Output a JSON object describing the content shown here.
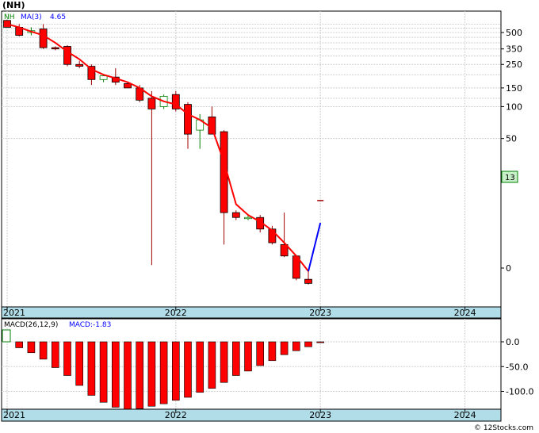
{
  "ticker": "(NH)",
  "price_legend": {
    "symbol": "NH",
    "ma_label": "MA(3)",
    "ma_value": "4.65"
  },
  "macd_legend": {
    "label": "MACD(26,12,9)",
    "value_label": "MACD:-1.83"
  },
  "last_price_badge": "13",
  "copyright": "© 12Stocks.com",
  "colors": {
    "up": "#ffffff",
    "down": "#ff0000",
    "ma_line": "#ff0000",
    "ma_last": "#0000ff",
    "legend_symbol": "#008000",
    "legend_ma": "#0000ff",
    "axis_bar": "#b0dde8",
    "badge_bg": "#c8f0c8",
    "badge_border": "#008000"
  },
  "chart_data": [
    {
      "type": "candlestick",
      "title": "(NH)",
      "scale": "log",
      "y_tick_labels": [
        "500",
        "350",
        "250",
        "150",
        "100",
        "50",
        "0"
      ],
      "y_tick_values": [
        500,
        350,
        250,
        150,
        100,
        50,
        3
      ],
      "x_tick_labels": [
        "2021",
        "2022",
        "2023",
        "2024"
      ],
      "x_tick_months": [
        0,
        14,
        26,
        38
      ],
      "grid": true,
      "ohlc": [
        {
          "m": 0,
          "o": 650,
          "h": 660,
          "l": 560,
          "c": 560
        },
        {
          "m": 1,
          "o": 560,
          "h": 600,
          "l": 460,
          "c": 470
        },
        {
          "m": 2,
          "o": 500,
          "h": 560,
          "l": 470,
          "c": 520
        },
        {
          "m": 3,
          "o": 540,
          "h": 600,
          "l": 350,
          "c": 360
        },
        {
          "m": 4,
          "o": 360,
          "h": 370,
          "l": 340,
          "c": 350
        },
        {
          "m": 5,
          "o": 370,
          "h": 380,
          "l": 240,
          "c": 250
        },
        {
          "m": 6,
          "o": 250,
          "h": 270,
          "l": 230,
          "c": 240
        },
        {
          "m": 7,
          "o": 240,
          "h": 250,
          "l": 160,
          "c": 180
        },
        {
          "m": 8,
          "o": 180,
          "h": 200,
          "l": 170,
          "c": 195
        },
        {
          "m": 9,
          "o": 190,
          "h": 230,
          "l": 160,
          "c": 170
        },
        {
          "m": 10,
          "o": 165,
          "h": 170,
          "l": 150,
          "c": 150
        },
        {
          "m": 11,
          "o": 150,
          "h": 160,
          "l": 110,
          "c": 115
        },
        {
          "m": 12,
          "o": 120,
          "h": 140,
          "l": 3.2,
          "c": 95
        },
        {
          "m": 13,
          "o": 100,
          "h": 130,
          "l": 95,
          "c": 125
        },
        {
          "m": 14,
          "o": 130,
          "h": 140,
          "l": 90,
          "c": 95
        },
        {
          "m": 15,
          "o": 105,
          "h": 110,
          "l": 40,
          "c": 55
        },
        {
          "m": 16,
          "o": 60,
          "h": 85,
          "l": 40,
          "c": 75
        },
        {
          "m": 17,
          "o": 80,
          "h": 100,
          "l": 55,
          "c": 55
        },
        {
          "m": 18,
          "o": 58,
          "h": 60,
          "l": 5,
          "c": 10
        },
        {
          "m": 19,
          "o": 10,
          "h": 10.5,
          "l": 8.5,
          "c": 9
        },
        {
          "m": 20,
          "o": 9,
          "h": 9.5,
          "l": 8.5,
          "c": 9
        },
        {
          "m": 21,
          "o": 9,
          "h": 9.5,
          "l": 6.5,
          "c": 7
        },
        {
          "m": 22,
          "o": 7,
          "h": 7.5,
          "l": 5,
          "c": 5.2
        },
        {
          "m": 23,
          "o": 5,
          "h": 10,
          "l": 3.8,
          "c": 3.9
        },
        {
          "m": 24,
          "o": 3.9,
          "h": 4,
          "l": 2.3,
          "c": 2.4
        },
        {
          "m": 25,
          "o": 2.35,
          "h": 2.8,
          "l": 2.1,
          "c": 2.15
        }
      ],
      "last_tick": {
        "m": 26,
        "value": 13
      },
      "ma": [
        {
          "m": 0,
          "v": 600
        },
        {
          "m": 1,
          "v": 560
        },
        {
          "m": 2,
          "v": 510
        },
        {
          "m": 3,
          "v": 470
        },
        {
          "m": 4,
          "v": 400
        },
        {
          "m": 5,
          "v": 330
        },
        {
          "m": 6,
          "v": 280
        },
        {
          "m": 7,
          "v": 225
        },
        {
          "m": 8,
          "v": 200
        },
        {
          "m": 9,
          "v": 185
        },
        {
          "m": 10,
          "v": 170
        },
        {
          "m": 11,
          "v": 150
        },
        {
          "m": 12,
          "v": 125
        },
        {
          "m": 13,
          "v": 112
        },
        {
          "m": 14,
          "v": 105
        },
        {
          "m": 15,
          "v": 85
        },
        {
          "m": 16,
          "v": 75
        },
        {
          "m": 17,
          "v": 63
        },
        {
          "m": 18,
          "v": 30
        },
        {
          "m": 19,
          "v": 12
        },
        {
          "m": 20,
          "v": 9.5
        },
        {
          "m": 21,
          "v": 8.2
        },
        {
          "m": 22,
          "v": 6.8
        },
        {
          "m": 23,
          "v": 5.2
        },
        {
          "m": 24,
          "v": 3.9
        },
        {
          "m": 25,
          "v": 2.8
        },
        {
          "m": 26,
          "v": 8
        }
      ]
    },
    {
      "type": "bar",
      "title": "MACD(26,12,9)",
      "y_tick_labels": [
        "0.0",
        "-50.0",
        "-100.0"
      ],
      "y_tick_values": [
        0,
        -50,
        -100
      ],
      "ylim": [
        -135,
        22
      ],
      "x_tick_labels": [
        "2021",
        "2022",
        "2023",
        "2024"
      ],
      "x_tick_months": [
        0,
        14,
        26,
        38
      ],
      "values": [
        -12,
        -22,
        -35,
        -52,
        -68,
        -88,
        -108,
        -122,
        -132,
        -137,
        -135,
        -130,
        -125,
        -118,
        -112,
        -102,
        -94,
        -82,
        -68,
        -59,
        -48,
        -38,
        -26,
        -18,
        -10,
        -1.83
      ]
    }
  ]
}
